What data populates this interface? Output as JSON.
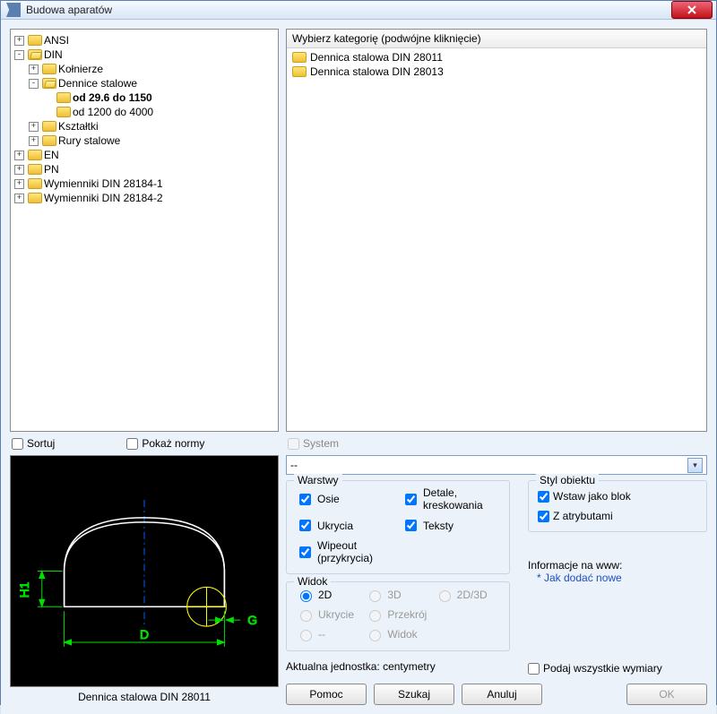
{
  "window": {
    "title": "Budowa aparatów"
  },
  "tree": {
    "nodes": [
      {
        "exp": "+",
        "label": "ANSI"
      },
      {
        "exp": "-",
        "label": "DIN",
        "open": true,
        "children": [
          {
            "exp": "+",
            "label": "Kołnierze"
          },
          {
            "exp": "-",
            "label": "Dennice stalowe",
            "open": true,
            "children": [
              {
                "exp": "",
                "label": "od 29.6 do 1150",
                "bold": true,
                "special": true
              },
              {
                "exp": "",
                "label": "od 1200 do 4000"
              }
            ]
          },
          {
            "exp": "+",
            "label": "Kształtki"
          },
          {
            "exp": "+",
            "label": "Rury stalowe"
          }
        ]
      },
      {
        "exp": "+",
        "label": "EN"
      },
      {
        "exp": "+",
        "label": "PN"
      },
      {
        "exp": "+",
        "label": "Wymienniki DIN 28184-1"
      },
      {
        "exp": "+",
        "label": "Wymienniki DIN 28184-2"
      }
    ]
  },
  "list": {
    "header": "Wybierz kategorię (podwójne kliknięcie)",
    "items": [
      "Dennica stalowa DIN 28011",
      "Dennica stalowa DIN 28013"
    ]
  },
  "mid": {
    "sort": "Sortuj",
    "show_norms": "Pokaż normy",
    "system": "System"
  },
  "dropdown": {
    "value": "--"
  },
  "layers": {
    "legend": "Warstwy",
    "axes": "Osie",
    "details": "Detale, kreskowania",
    "hides": "Ukrycia",
    "texts": "Teksty",
    "wipeout": "Wipeout (przykrycia)"
  },
  "view": {
    "legend": "Widok",
    "r2d": "2D",
    "r3d": "3D",
    "r2d3d": "2D/3D",
    "hide": "Ukrycie",
    "section": "Przekrój",
    "dash": "--",
    "widok": "Widok"
  },
  "style": {
    "legend": "Styl obiektu",
    "block": "Wstaw jako blok",
    "attrs": "Z atrybutami"
  },
  "info": {
    "label": "Informacje na www:",
    "link": "* Jak dodać nowe"
  },
  "dims_check": "Podaj wszystkie wymiary",
  "unit": {
    "label": "Aktualna jednostka: centymetry"
  },
  "preview": {
    "caption": "Dennica stalowa DIN 28011",
    "dims": {
      "H1": "H1",
      "D": "D",
      "G": "G"
    }
  },
  "buttons": {
    "help": "Pomoc",
    "search": "Szukaj",
    "cancel": "Anuluj",
    "ok": "OK"
  }
}
